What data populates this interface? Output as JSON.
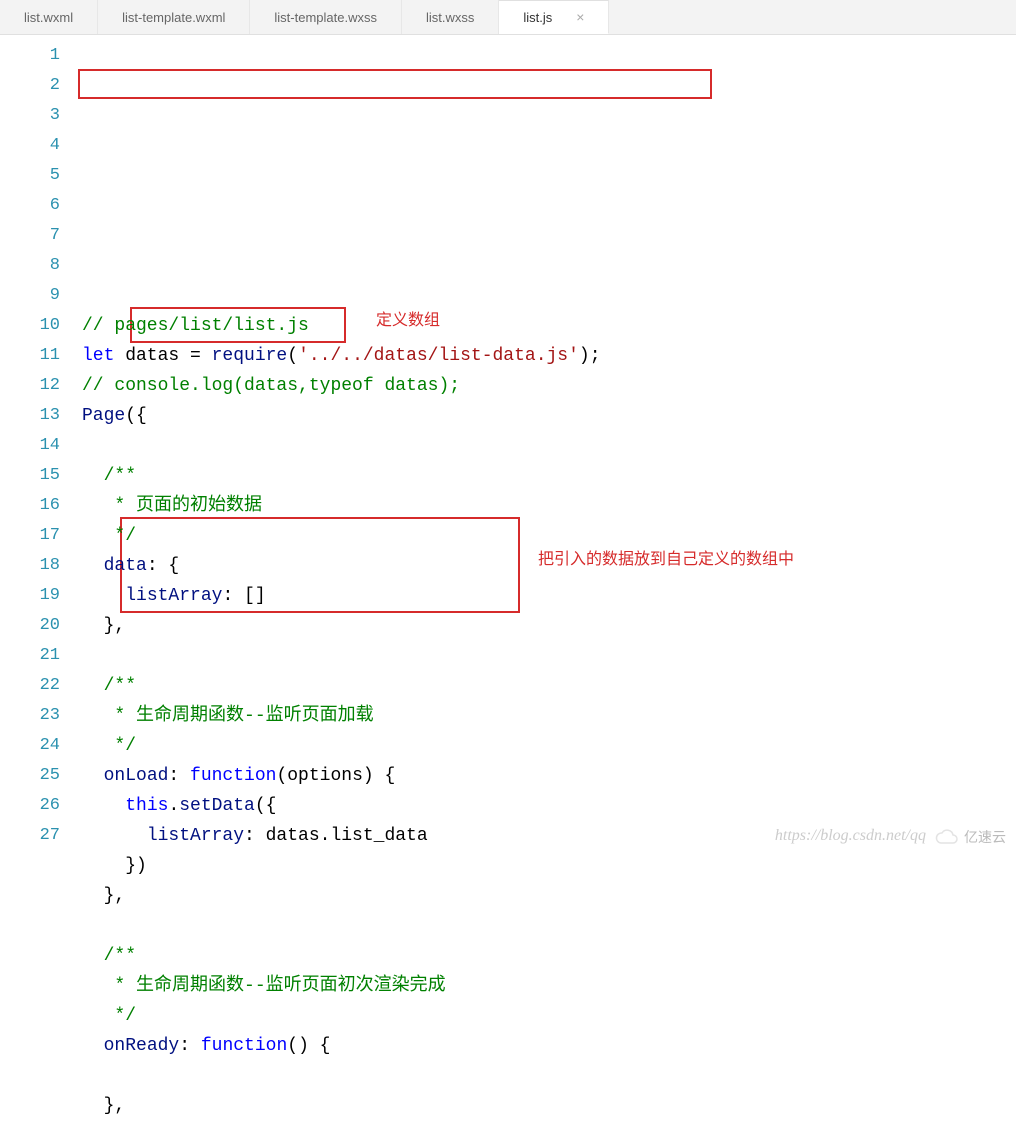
{
  "tabs": [
    {
      "label": "list.wxml",
      "active": false
    },
    {
      "label": "list-template.wxml",
      "active": false
    },
    {
      "label": "list-template.wxss",
      "active": false
    },
    {
      "label": "list.wxss",
      "active": false
    },
    {
      "label": "list.js",
      "active": true
    }
  ],
  "lines": [
    {
      "n": 1,
      "segments": [
        {
          "cls": "c-comment",
          "t": "// pages/list/list.js"
        }
      ]
    },
    {
      "n": 2,
      "segments": [
        {
          "cls": "c-keyword",
          "t": "let"
        },
        {
          "cls": "c-text",
          "t": " datas = "
        },
        {
          "cls": "c-ident",
          "t": "require"
        },
        {
          "cls": "c-text",
          "t": "("
        },
        {
          "cls": "c-string",
          "t": "'../../datas/list-data.js'"
        },
        {
          "cls": "c-text",
          "t": ");"
        }
      ]
    },
    {
      "n": 3,
      "segments": [
        {
          "cls": "c-comment",
          "t": "// console.log(datas,typeof datas);"
        }
      ]
    },
    {
      "n": 4,
      "segments": [
        {
          "cls": "c-ident",
          "t": "Page"
        },
        {
          "cls": "c-text",
          "t": "({"
        }
      ]
    },
    {
      "n": 5,
      "segments": []
    },
    {
      "n": 6,
      "segments": [
        {
          "cls": "c-text",
          "t": "  "
        },
        {
          "cls": "c-comment",
          "t": "/**"
        }
      ]
    },
    {
      "n": 7,
      "segments": [
        {
          "cls": "c-text",
          "t": "  "
        },
        {
          "cls": "c-comment",
          "t": " * 页面的初始数据"
        }
      ]
    },
    {
      "n": 8,
      "segments": [
        {
          "cls": "c-text",
          "t": "  "
        },
        {
          "cls": "c-comment",
          "t": " */"
        }
      ]
    },
    {
      "n": 9,
      "segments": [
        {
          "cls": "c-text",
          "t": "  "
        },
        {
          "cls": "c-prop",
          "t": "data"
        },
        {
          "cls": "c-text",
          "t": ": {"
        }
      ]
    },
    {
      "n": 10,
      "segments": [
        {
          "cls": "c-text",
          "t": "    "
        },
        {
          "cls": "c-prop",
          "t": "listArray"
        },
        {
          "cls": "c-text",
          "t": ": []"
        }
      ]
    },
    {
      "n": 11,
      "segments": [
        {
          "cls": "c-text",
          "t": "  },"
        }
      ]
    },
    {
      "n": 12,
      "segments": []
    },
    {
      "n": 13,
      "segments": [
        {
          "cls": "c-text",
          "t": "  "
        },
        {
          "cls": "c-comment",
          "t": "/**"
        }
      ]
    },
    {
      "n": 14,
      "segments": [
        {
          "cls": "c-text",
          "t": "  "
        },
        {
          "cls": "c-comment",
          "t": " * 生命周期函数--监听页面加载"
        }
      ]
    },
    {
      "n": 15,
      "segments": [
        {
          "cls": "c-text",
          "t": "  "
        },
        {
          "cls": "c-comment",
          "t": " */"
        }
      ]
    },
    {
      "n": 16,
      "segments": [
        {
          "cls": "c-text",
          "t": "  "
        },
        {
          "cls": "c-prop",
          "t": "onLoad"
        },
        {
          "cls": "c-text",
          "t": ": "
        },
        {
          "cls": "c-func",
          "t": "function"
        },
        {
          "cls": "c-text",
          "t": "(options) {"
        }
      ]
    },
    {
      "n": 17,
      "segments": [
        {
          "cls": "c-text",
          "t": "    "
        },
        {
          "cls": "c-keyword",
          "t": "this"
        },
        {
          "cls": "c-text",
          "t": "."
        },
        {
          "cls": "c-ident",
          "t": "setData"
        },
        {
          "cls": "c-text",
          "t": "({"
        }
      ]
    },
    {
      "n": 18,
      "segments": [
        {
          "cls": "c-text",
          "t": "      "
        },
        {
          "cls": "c-prop",
          "t": "listArray"
        },
        {
          "cls": "c-text",
          "t": ": datas.list_data"
        }
      ]
    },
    {
      "n": 19,
      "segments": [
        {
          "cls": "c-text",
          "t": "    })"
        }
      ]
    },
    {
      "n": 20,
      "segments": [
        {
          "cls": "c-text",
          "t": "  },"
        }
      ]
    },
    {
      "n": 21,
      "segments": []
    },
    {
      "n": 22,
      "segments": [
        {
          "cls": "c-text",
          "t": "  "
        },
        {
          "cls": "c-comment",
          "t": "/**"
        }
      ]
    },
    {
      "n": 23,
      "segments": [
        {
          "cls": "c-text",
          "t": "  "
        },
        {
          "cls": "c-comment",
          "t": " * 生命周期函数--监听页面初次渲染完成"
        }
      ]
    },
    {
      "n": 24,
      "segments": [
        {
          "cls": "c-text",
          "t": "  "
        },
        {
          "cls": "c-comment",
          "t": " */"
        }
      ]
    },
    {
      "n": 25,
      "segments": [
        {
          "cls": "c-text",
          "t": "  "
        },
        {
          "cls": "c-prop",
          "t": "onReady"
        },
        {
          "cls": "c-text",
          "t": ": "
        },
        {
          "cls": "c-func",
          "t": "function"
        },
        {
          "cls": "c-text",
          "t": "() {"
        }
      ]
    },
    {
      "n": 26,
      "segments": []
    },
    {
      "n": 27,
      "segments": [
        {
          "cls": "c-text",
          "t": "  },"
        }
      ]
    }
  ],
  "annotations": {
    "a1": "定义数组",
    "a2": "把引入的数据放到自己定义的数组中"
  },
  "watermark": "https://blog.csdn.net/qq",
  "logo_text": "亿速云"
}
